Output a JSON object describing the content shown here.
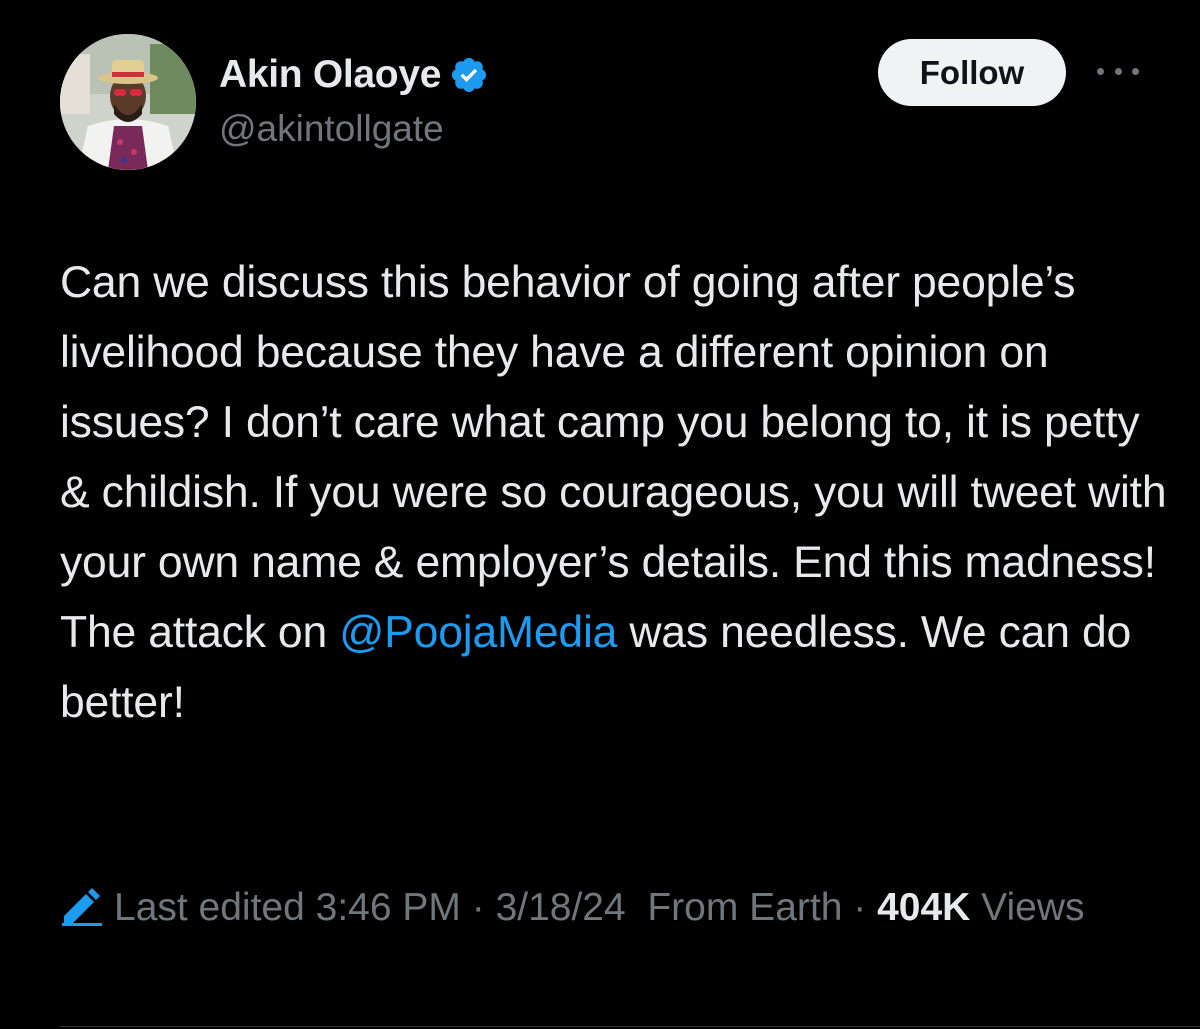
{
  "author": {
    "display_name": "Akin Olaoye",
    "handle": "@akintollgate",
    "verified": true,
    "avatar": "avatar"
  },
  "actions": {
    "follow_label": "Follow",
    "more_icon": "more-horizontal-icon"
  },
  "tweet": {
    "segments": [
      "Can we discuss this behavior of going after people’s livelihood because they have a different opinion on issues? I don’t care what camp you belong to, it is petty & childish. If you were so courageous, you will tweet with your own name & employer’s details. End this madness! The attack on ",
      "@PoojaMedia",
      " was needless. We can do better!"
    ]
  },
  "meta": {
    "edit_icon": "pencil-icon",
    "edited_label": "Last edited 3:46 PM",
    "separator": " · ",
    "date": "3/18/24",
    "source": "From Earth",
    "views_count": "404K",
    "views_label": "Views"
  },
  "colors": {
    "background": "#000000",
    "text": "#e7e9ea",
    "secondary_text": "#71767b",
    "link": "#1d9bf0",
    "verified_badge": "#1d9bf0",
    "follow_button_bg": "#eff3f4"
  }
}
